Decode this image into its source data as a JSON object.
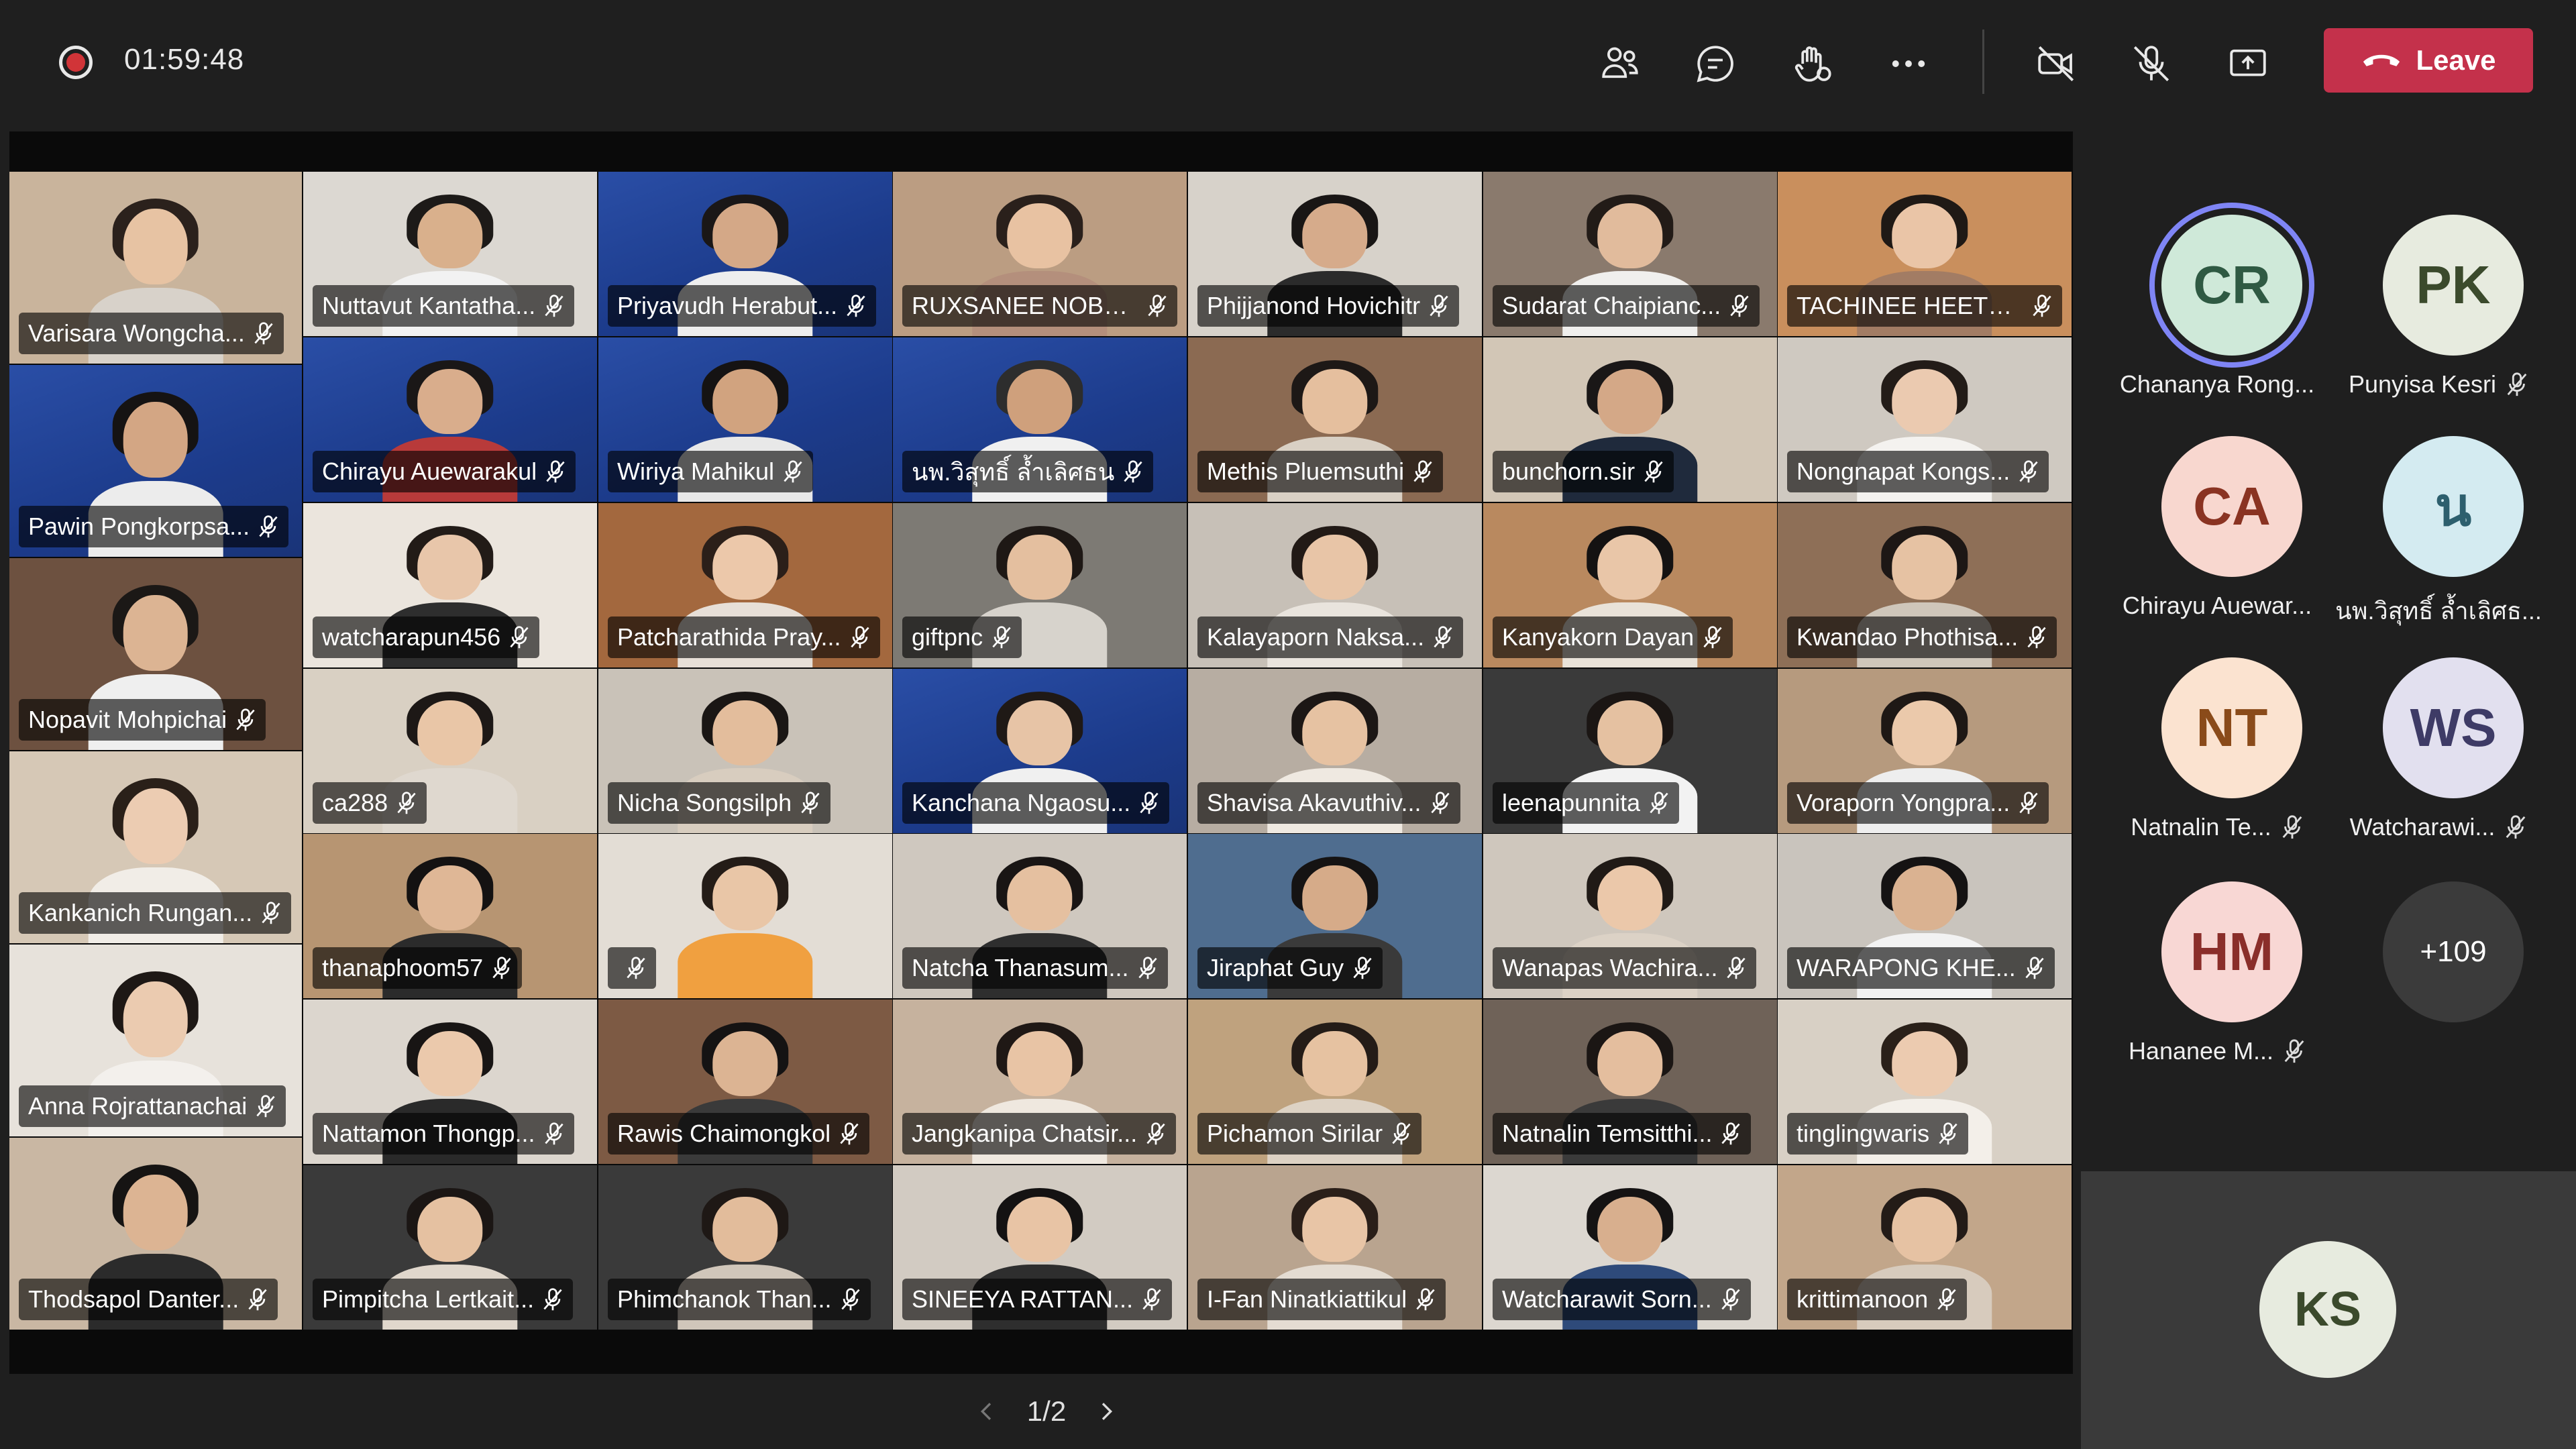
{
  "meeting": {
    "elapsed": "01:59:48"
  },
  "toolbar": {
    "leave_label": "Leave",
    "icons": [
      "people-icon",
      "chat-icon",
      "raise-hand-icon",
      "more-options-icon",
      "camera-off-icon",
      "mic-off-icon",
      "share-screen-icon",
      "phone-hangup-icon"
    ]
  },
  "tiles": [
    {
      "name": "Varisara Wongcha...",
      "bg": "#c9b49c",
      "skin": "#e7c3a3",
      "hair": "#2b211c",
      "shirt": "#d8d2ca"
    },
    {
      "name": "Nuttavut Kantatha...",
      "bg": "#dcd8d2",
      "skin": "#d9b08c",
      "hair": "#1d1a18",
      "shirt": "#f2f2f2"
    },
    {
      "name": "Priyavudh Herabut...",
      "bg": "blue",
      "skin": "#d4a887",
      "hair": "#1a1717",
      "shirt": "#eeeeee"
    },
    {
      "name": "RUXSANEE NOBN...",
      "bg": "#bb9d82",
      "skin": "#e8c2a2",
      "hair": "#2a201b",
      "shirt": "#b48f7c"
    },
    {
      "name": "Phijjanond Hovichitr",
      "bg": "#d7d2ca",
      "skin": "#d6ab8b",
      "hair": "#191615",
      "shirt": "#2b2b2b"
    },
    {
      "name": "Sudarat Chaipianc...",
      "bg": "#8a7a6d",
      "skin": "#e1bb9c",
      "hair": "#221b17",
      "shirt": "#f0efed"
    },
    {
      "name": "TACHINEE HEETCH...",
      "bg": "#c98f5d",
      "skin": "#eac5a7",
      "hair": "#1f1915",
      "shirt": "#a27c64"
    },
    {
      "name": "Pawin Pongkorpsa...",
      "bg": "blue",
      "skin": "#d3a684",
      "hair": "#151313",
      "shirt": "#ececec"
    },
    {
      "name": "Chirayu Auewarakul",
      "bg": "blue",
      "skin": "#d9ad8c",
      "hair": "#1a1717",
      "shirt": "#b83a3a"
    },
    {
      "name": "Wiriya Mahikul",
      "bg": "blue",
      "skin": "#d1a37f",
      "hair": "#151313",
      "shirt": "#e8e8e8"
    },
    {
      "name": "นพ.วิสุทธิ์ ล้ำเลิศธน",
      "bg": "blue",
      "skin": "#cfa07c",
      "hair": "#2d2d2d",
      "shirt": "#f0f0f0"
    },
    {
      "name": "Methis Pluemsuthi",
      "bg": "#8b6a52",
      "skin": "#e5bf9e",
      "hair": "#1d1816",
      "shirt": "#d9d0c4"
    },
    {
      "name": "bunchorn.sir",
      "bg": "#d2c6b6",
      "skin": "#d4a887",
      "hair": "#1a1717",
      "shirt": "#1f2a3c"
    },
    {
      "name": "Nongnapat Kongs...",
      "bg": "#cfc9c1",
      "skin": "#ebcab0",
      "hair": "#231c18",
      "shirt": "#f4f2ef"
    },
    {
      "name": "Nopavit Mohpichai",
      "bg": "#6d5140",
      "skin": "#dcb493",
      "hair": "#1b1816",
      "shirt": "#efefef"
    },
    {
      "name": "watcharapun456",
      "bg": "#ebe5dd",
      "skin": "#e8c6aa",
      "hair": "#221b17",
      "shirt": "#2e2e2e"
    },
    {
      "name": "Patcharathida Pray...",
      "bg": "#a3683e",
      "skin": "#ecc8aa",
      "hair": "#2b1f19",
      "shirt": "#e7dfd7"
    },
    {
      "name": "giftpnc",
      "bg": "#7d7a74",
      "skin": "#e4bf9f",
      "hair": "#1e1815",
      "shirt": "#d7d3cc"
    },
    {
      "name": "Kalayaporn Naksa...",
      "bg": "#c7c0b7",
      "skin": "#e8c5a7",
      "hair": "#221a16",
      "shirt": "#e9e4dd"
    },
    {
      "name": "Kanyakorn Dayan",
      "bg": "#b9895f",
      "skin": "#e9c6a8",
      "hair": "#141212",
      "shirt": "#e9e2d8"
    },
    {
      "name": "Kwandao Phothisa...",
      "bg": "#8e6f57",
      "skin": "#e6c2a3",
      "hair": "#1d1715",
      "shirt": "#cfc6ba"
    },
    {
      "name": "Kankanich Rungan...",
      "bg": "#d6c8b6",
      "skin": "#ecccb2",
      "hair": "#2a2019",
      "shirt": "#f1ede7"
    },
    {
      "name": "ca288",
      "bg": "#d9d0c3",
      "skin": "#e9c6a7",
      "hair": "#1d1816",
      "shirt": "#dfd8cf"
    },
    {
      "name": "Nicha Songsilph",
      "bg": "#c9c2b8",
      "skin": "#e3bd9c",
      "hair": "#1a1614",
      "shirt": "#d8cdbf"
    },
    {
      "name": "Kanchana Ngaosu...",
      "bg": "blue",
      "skin": "#e7c4a6",
      "hair": "#1f1916",
      "shirt": "#f0f0f0"
    },
    {
      "name": "Shavisa Akavuthiv...",
      "bg": "#b7ada2",
      "skin": "#e6c2a2",
      "hair": "#1c1715",
      "shirt": "#efe9e1"
    },
    {
      "name": "leenapunnita",
      "bg": "#3a3a3a",
      "skin": "#e5c1a1",
      "hair": "#1b1614",
      "shirt": "#f2f2f2"
    },
    {
      "name": "Voraporn Yongpra...",
      "bg": "#b69a7e",
      "skin": "#ebc9ab",
      "hair": "#1e1815",
      "shirt": "#eeeeee"
    },
    {
      "name": "Anna Rojrattanachai",
      "bg": "#e7e2db",
      "skin": "#ebcbb0",
      "hair": "#1e1815",
      "shirt": "#f3f0ec"
    },
    {
      "name": "thanaphoom57",
      "bg": "#b79572",
      "skin": "#dfb796",
      "hair": "#141212",
      "shirt": "#2b2b2b"
    },
    {
      "name": "",
      "bg": "#e3ddd5",
      "skin": "#e9c6a7",
      "hair": "#241c17",
      "shirt": "#f0a040"
    },
    {
      "name": "Natcha Thanasum...",
      "bg": "#cfc8bf",
      "skin": "#e5c0a0",
      "hair": "#191514",
      "shirt": "#2e2e2e"
    },
    {
      "name": "Jiraphat Guy",
      "bg": "#4f6d8f",
      "skin": "#d6ab89",
      "hair": "#151313",
      "shirt": "#3a3a3a"
    },
    {
      "name": "Wanapas Wachira...",
      "bg": "#cfc7bd",
      "skin": "#ebc8aa",
      "hair": "#201a16",
      "shirt": "#dcd2c6"
    },
    {
      "name": "WARAPONG KHE...",
      "bg": "#c9c4bd",
      "skin": "#dab291",
      "hair": "#151313",
      "shirt": "#f2f2f2"
    },
    {
      "name": "Thodsapol Danter...",
      "bg": "#c9b7a3",
      "skin": "#dcb493",
      "hair": "#161413",
      "shirt": "#2b2b2b"
    },
    {
      "name": "Nattamon Thongp...",
      "bg": "#dcd6ce",
      "skin": "#ebc9ac",
      "hair": "#181514",
      "shirt": "#2a2a2a"
    },
    {
      "name": "Rawis Chaimongkol",
      "bg": "#7d5a44",
      "skin": "#dcb493",
      "hair": "#151313",
      "shirt": "#3a3a3a"
    },
    {
      "name": "Jangkanipa Chatsir...",
      "bg": "#c6b29e",
      "skin": "#e8c4a5",
      "hair": "#1f1815",
      "shirt": "#efe8df"
    },
    {
      "name": "Pichamon Sirilar",
      "bg": "#bfa27e",
      "skin": "#e6c2a1",
      "hair": "#241c17",
      "shirt": "#ddd2c4"
    },
    {
      "name": "Natnalin Temsitthi...",
      "bg": "#6f6258",
      "skin": "#e4be9e",
      "hair": "#1b1614",
      "shirt": "#3a3a3a"
    },
    {
      "name": "tinglingwaris",
      "bg": "#d8d0c5",
      "skin": "#eccbb0",
      "hair": "#2a2019",
      "shirt": "#f3efe9"
    },
    {
      "name": "Pimpitcha Lertkait...",
      "bg": "#3a3a3a",
      "skin": "#e5c1a1",
      "hair": "#1b1614",
      "shirt": "#e0d7cc"
    },
    {
      "name": "Phimchanok Than...",
      "bg": "#3a3a3a",
      "skin": "#e2bc9b",
      "hair": "#1e1815",
      "shirt": "#d0c6ba"
    },
    {
      "name": "SINEEYA RATTAN...",
      "bg": "#d2cbc2",
      "skin": "#e8c4a5",
      "hair": "#141212",
      "shirt": "#2e2e2e"
    },
    {
      "name": "I-Fan Ninatkiattikul",
      "bg": "#b9a48f",
      "skin": "#e8c5a6",
      "hair": "#2a1f19",
      "shirt": "#e4dcd2"
    },
    {
      "name": "Watcharawit Sorn...",
      "bg": "#dcd7d0",
      "skin": "#d8af8e",
      "hair": "#151313",
      "shirt": "#2e4a7a"
    },
    {
      "name": "krittimanoon",
      "bg": "#c2a68a",
      "skin": "#e6c2a3",
      "hair": "#231b17",
      "shirt": "#d7cbbd"
    }
  ],
  "pagination": {
    "label": "1/2"
  },
  "sidebar": {
    "participants": [
      {
        "initials": "CR",
        "name": "Chananya Rong...",
        "bg": "#cfe9d9",
        "fg": "#2f5a43",
        "muted": false,
        "speaking": true
      },
      {
        "initials": "PK",
        "name": "Punyisa Kesri",
        "bg": "#e7ebdf",
        "fg": "#3b4a2c",
        "muted": true,
        "speaking": false
      },
      {
        "initials": "CA",
        "name": "Chirayu Auewar...",
        "bg": "#f8d7cf",
        "fg": "#8a3322",
        "muted": false,
        "speaking": false
      },
      {
        "initials": "น",
        "name": "นพ.วิสุทธิ์ ล้ำเลิศธ...",
        "bg": "#d4ebf1",
        "fg": "#2d5f6e",
        "muted": false,
        "speaking": false
      },
      {
        "initials": "NT",
        "name": "Natnalin Te...",
        "bg": "#fbe3d0",
        "fg": "#8a4b1a",
        "muted": true,
        "speaking": false
      },
      {
        "initials": "WS",
        "name": "Watcharawi...",
        "bg": "#e2e0ef",
        "fg": "#3e3b66",
        "muted": true,
        "speaking": false
      },
      {
        "initials": "HM",
        "name": "Hananee M...",
        "bg": "#f8d7d4",
        "fg": "#8a2e2a",
        "muted": true,
        "speaking": false
      }
    ],
    "more_count": "+109"
  },
  "self_view": {
    "initials": "KS"
  }
}
